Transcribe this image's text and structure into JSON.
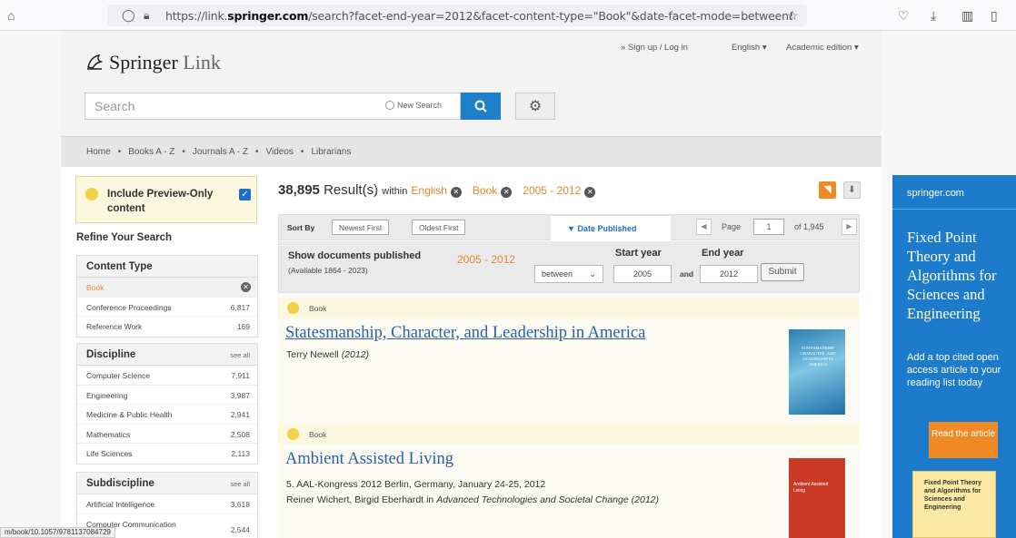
{
  "browser": {
    "url_prefix": "https://link.",
    "url_domain": "springer.com",
    "url_rest": "/search?facet-end-year=2012&facet-content-type=\"Book\"&date-facet-mode=between&facet-l",
    "status_url": "m/book/10.1057/9781137084729"
  },
  "header": {
    "logo_main": "Springer",
    "logo_sub": "Link",
    "signup": "» Sign up / Log in",
    "language": "English",
    "edition": "Academic edition",
    "search_placeholder": "Search",
    "new_search": "New Search"
  },
  "nav": {
    "items": [
      "Home",
      "Books A - Z",
      "Journals A - Z",
      "Videos",
      "Librarians"
    ],
    "sep": "•"
  },
  "sidebar": {
    "preview_label": "Include Preview-Only content",
    "refine_title": "Refine Your Search",
    "facets": [
      {
        "title": "Content Type",
        "see_all": "",
        "rows": [
          {
            "name": "Book",
            "count": "",
            "selected": true
          },
          {
            "name": "Conference Proceedings",
            "count": "6,817"
          },
          {
            "name": "Reference Work",
            "count": "169"
          }
        ]
      },
      {
        "title": "Discipline",
        "see_all": "see all",
        "rows": [
          {
            "name": "Computer Science",
            "count": "7,911"
          },
          {
            "name": "Engineering",
            "count": "3,987"
          },
          {
            "name": "Medicine & Public Health",
            "count": "2,941"
          },
          {
            "name": "Mathematics",
            "count": "2,508"
          },
          {
            "name": "Life Sciences",
            "count": "2,113"
          }
        ]
      },
      {
        "title": "Subdiscipline",
        "see_all": "see all",
        "rows": [
          {
            "name": "Artificial Intelligence",
            "count": "3,618"
          },
          {
            "name": "Computer Communication",
            "count": "2,544"
          }
        ]
      }
    ]
  },
  "results": {
    "count": "38,895",
    "label": "Result(s)",
    "within": "within",
    "filters": [
      "English",
      "Book",
      "2005 - 2012"
    ],
    "sort_by": "Sort By",
    "newest_first": "Newest First",
    "oldest_first": "Oldest First",
    "date_published": "Date Published",
    "page_label": "Page",
    "page_value": "1",
    "page_total": "of 1,945",
    "show_docs": "Show documents published",
    "available": "(Available 1864 - 2023)",
    "range": "2005 - 2012",
    "start_year_label": "Start year",
    "end_year_label": "End year",
    "mode": "between",
    "start_year": "2005",
    "and": "and",
    "end_year": "2012",
    "submit": "Submit",
    "items": [
      {
        "type": "Book",
        "title": "Statesmanship, Character, and Leadership in America",
        "author": "Terry Newell",
        "year": "(2012)",
        "cover_title": "STATESMANSHIP, CHARACTER, AND LEADERSHIP IN AMERICA"
      },
      {
        "type": "Book",
        "title": "Ambient Assisted Living",
        "subtitle": "5. AAL-Kongress 2012 Berlin, Germany, January 24-25, 2012",
        "authors": "Reiner Wichert, Birgid Eberhardt",
        "in": "in",
        "series": "Advanced Technologies and Societal Change",
        "year": "(2012)",
        "cover_title": "Ambient Assisted Living"
      }
    ]
  },
  "ad": {
    "site": "springer.com",
    "headline": "Fixed Point Theory and Algorithms for Sciences and Engineering",
    "sub": "Add a top cited open access article to your reading list today",
    "button": "Read the article",
    "cover_text": "Fixed Point Theory and Algorithms for Sciences and Engineering"
  },
  "colors": {
    "accent_blue": "#1e7fcb",
    "filter_orange": "#e0892f",
    "ad_blue": "#1d7bcc"
  }
}
